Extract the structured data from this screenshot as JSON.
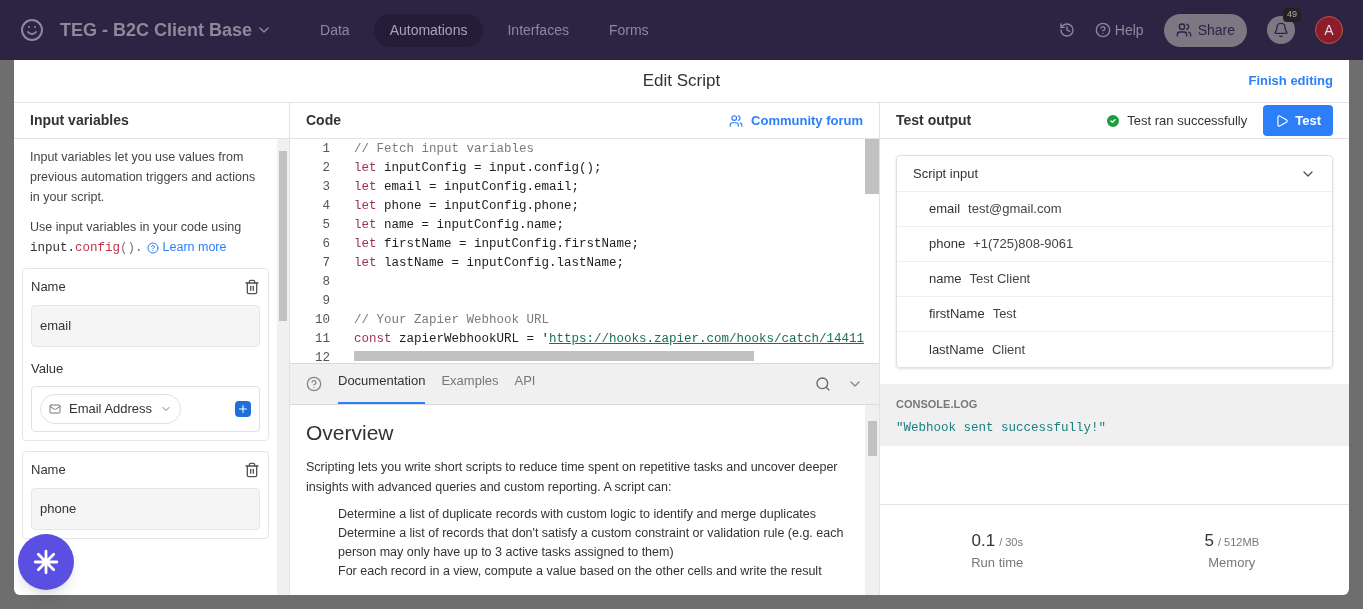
{
  "topbar": {
    "base_title": "TEG - B2C Client Base",
    "nav": [
      {
        "label": "Data",
        "selected": false
      },
      {
        "label": "Automations",
        "selected": true
      },
      {
        "label": "Interfaces",
        "selected": false
      },
      {
        "label": "Forms",
        "selected": false
      }
    ],
    "help": "Help",
    "share": "Share",
    "notifications": "49",
    "avatar": "A"
  },
  "modal": {
    "title": "Edit Script",
    "finish": "Finish editing"
  },
  "input_panel": {
    "title": "Input variables",
    "intro": "Input variables let you use values from previous automation triggers and actions in your script.",
    "usage": [
      {
        "kind": "text",
        "text": "Use input variables in your code using "
      },
      {
        "kind": "plain",
        "text": "input."
      },
      {
        "kind": "prop",
        "text": "config"
      },
      {
        "kind": "punct",
        "text": "()."
      }
    ],
    "learn_more": "Learn more",
    "variables": [
      {
        "name_label": "Name",
        "name": "email",
        "value_label": "Value",
        "value": "Email Address"
      },
      {
        "name_label": "Name",
        "name": "phone"
      }
    ]
  },
  "code_panel": {
    "title": "Code",
    "community": "Community forum",
    "lines": [
      {
        "number": "1",
        "segments": [
          {
            "kind": "comment",
            "text": "// Fetch input variables"
          }
        ]
      },
      {
        "number": "2",
        "segments": [
          {
            "kind": "keyword",
            "text": "let"
          },
          {
            "kind": "plain",
            "text": " inputConfig = input.config();"
          }
        ]
      },
      {
        "number": "3",
        "segments": [
          {
            "kind": "keyword",
            "text": "let"
          },
          {
            "kind": "plain",
            "text": " email = inputConfig.email;"
          }
        ]
      },
      {
        "number": "4",
        "segments": [
          {
            "kind": "keyword",
            "text": "let"
          },
          {
            "kind": "plain",
            "text": " phone = inputConfig.phone;"
          }
        ]
      },
      {
        "number": "5",
        "segments": [
          {
            "kind": "keyword",
            "text": "let"
          },
          {
            "kind": "plain",
            "text": " name = inputConfig.name;"
          }
        ]
      },
      {
        "number": "6",
        "segments": [
          {
            "kind": "keyword",
            "text": "let"
          },
          {
            "kind": "plain",
            "text": " firstName = inputConfig.firstName;"
          }
        ]
      },
      {
        "number": "7",
        "segments": [
          {
            "kind": "keyword",
            "text": "let"
          },
          {
            "kind": "plain",
            "text": " lastName = inputConfig.lastName;"
          }
        ]
      },
      {
        "number": "8"
      },
      {
        "number": "9"
      },
      {
        "number": "10",
        "segments": [
          {
            "kind": "comment",
            "text": "// Your Zapier Webhook URL"
          }
        ]
      },
      {
        "number": "11",
        "segments": [
          {
            "kind": "keyword",
            "text": "const"
          },
          {
            "kind": "plain",
            "text": " zapierWebhookURL = '"
          },
          {
            "kind": "url",
            "text": "https://hooks.zapier.com/hooks/catch/14411"
          }
        ]
      },
      {
        "number": "12"
      }
    ],
    "doc_tabs": [
      {
        "label": "Documentation",
        "selected": true
      },
      {
        "label": "Examples",
        "selected": false
      },
      {
        "label": "API",
        "selected": false
      }
    ],
    "doc_heading": "Overview",
    "doc_intro": "Scripting lets you write short scripts to reduce time spent on repetitive tasks and uncover deeper insights with advanced queries and custom reporting. A script can:",
    "doc_items": [
      "Determine a list of duplicate records with custom logic to identify and merge duplicates",
      "Determine a list of records that don't satisfy a custom constraint or validation rule (e.g. each person may only have up to 3 active tasks assigned to them)",
      "For each record in a view, compute a value based on the other cells and write the result"
    ]
  },
  "output_panel": {
    "title": "Test output",
    "status": "Test ran successfully",
    "test_button": "Test",
    "script_input_title": "Script input",
    "inputs": [
      {
        "key": "email",
        "value": "test@gmail.com"
      },
      {
        "key": "phone",
        "value": "+1(725)808-9061"
      },
      {
        "key": "name",
        "value": "Test Client"
      },
      {
        "key": "firstName",
        "value": "Test"
      },
      {
        "key": "lastName",
        "value": "Client"
      }
    ],
    "console_label": "CONSOLE.LOG",
    "console_output": "\"Webhook sent successfully!\"",
    "stats": [
      {
        "value": "0.1",
        "limit": "/ 30s",
        "label": "Run time"
      },
      {
        "value": "5",
        "limit": "/ 512MB",
        "label": "Memory"
      }
    ]
  }
}
